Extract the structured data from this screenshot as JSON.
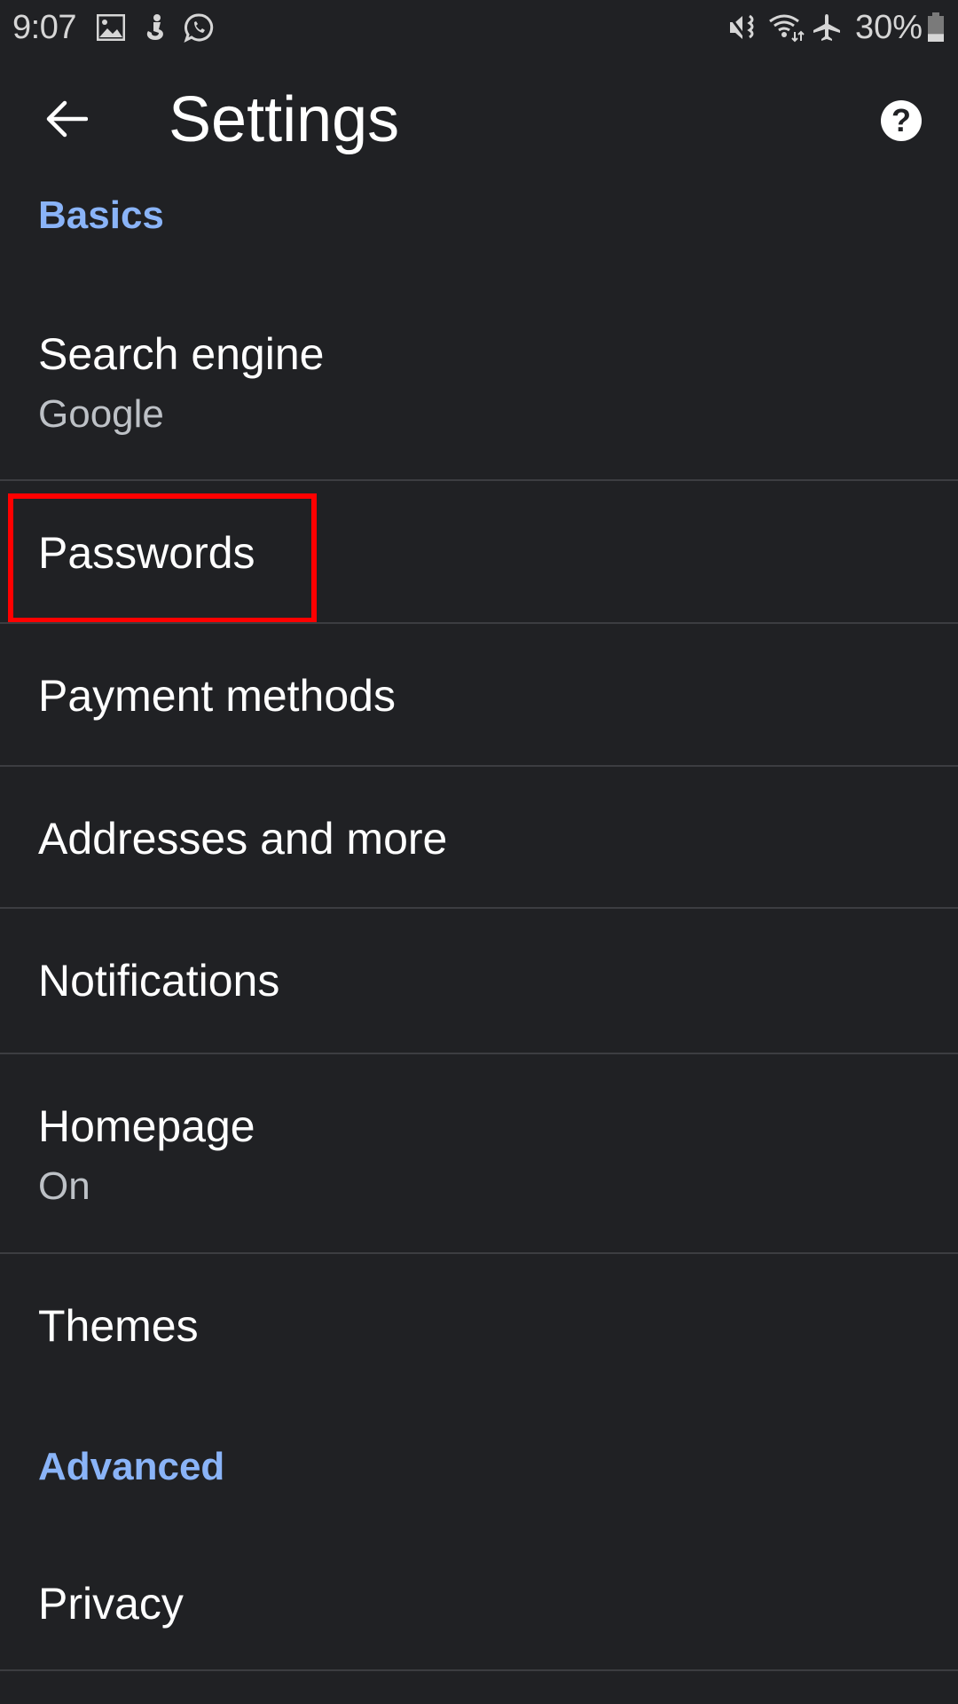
{
  "status_bar": {
    "time": "9:07",
    "left_icons": [
      "gallery-icon",
      "app-notification-icon",
      "whatsapp-icon"
    ],
    "right_icons": [
      "vibrate-mute-icon",
      "wifi-icon",
      "airplane-mode-icon"
    ],
    "battery_percent": "30%",
    "battery_level": 0.3
  },
  "app_bar": {
    "back_icon": "arrow-back-icon",
    "title": "Settings",
    "help_icon": "help-icon",
    "help_glyph": "?"
  },
  "sections": [
    {
      "header": "Basics",
      "items": [
        {
          "title": "Search engine",
          "subtitle": "Google"
        },
        {
          "title": "Passwords",
          "highlighted": true
        },
        {
          "title": "Payment methods"
        },
        {
          "title": "Addresses and more"
        },
        {
          "title": "Notifications"
        },
        {
          "title": "Homepage",
          "subtitle": "On"
        },
        {
          "title": "Themes"
        }
      ]
    },
    {
      "header": "Advanced",
      "items": [
        {
          "title": "Privacy"
        }
      ]
    }
  ],
  "colors": {
    "background": "#202124",
    "accent": "#8ab4f8",
    "subtitle": "#bdc1c6",
    "divider": "#3c3d41",
    "highlight": "#ff0000"
  }
}
